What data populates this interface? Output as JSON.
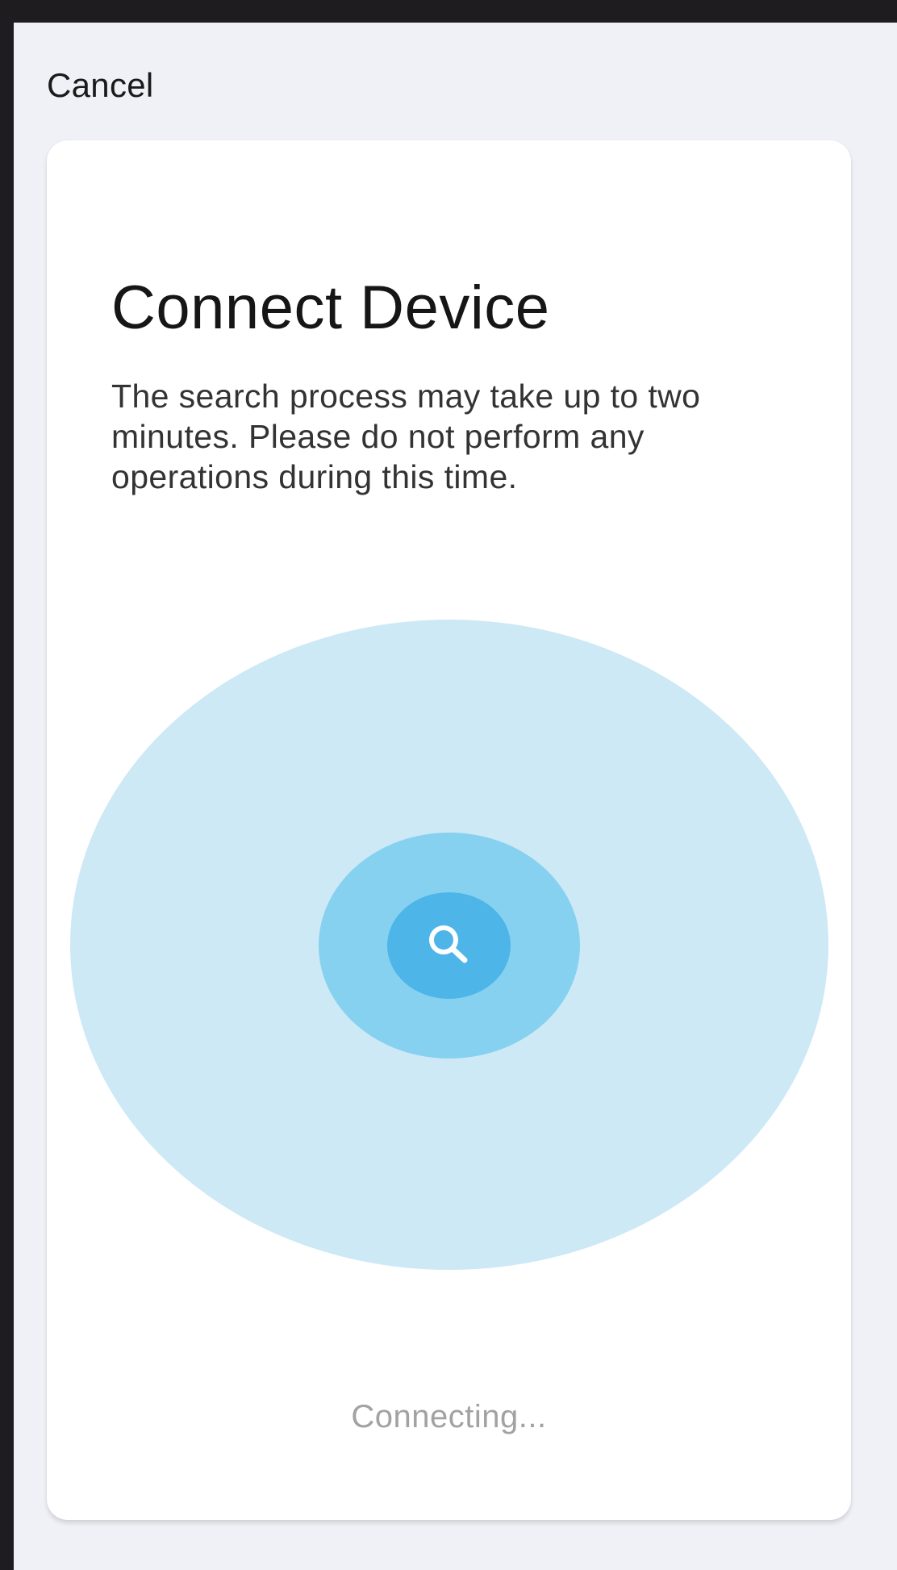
{
  "header": {
    "cancel_label": "Cancel"
  },
  "card": {
    "title": "Connect Device",
    "description": "The search process may take up to two minutes. Please do not perform any operations during this time.",
    "status_text": "Connecting..."
  },
  "radar": {
    "icon": "search-icon"
  },
  "colors": {
    "screen_background": "#f0f1f6",
    "card_background": "#ffffff",
    "radar_outer": "#cde9f5",
    "radar_middle": "#87d1f0",
    "radar_center": "#4db5e8",
    "status_text": "#a2a2a2"
  }
}
